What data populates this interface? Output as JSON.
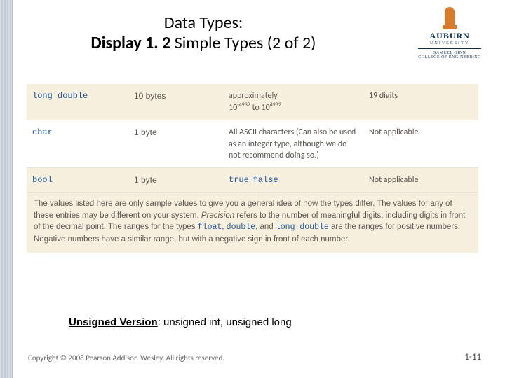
{
  "title": {
    "line1": "Data Types:",
    "boldPrefix": "Display 1. 2",
    "restLine2": "  Simple Types (2 of 2)"
  },
  "logo": {
    "name": "AUBURN",
    "sub": "UNIVERSITY",
    "college1": "SAMUEL GINN",
    "college2": "COLLEGE OF ENGINEERING"
  },
  "rows": [
    {
      "striped": true,
      "type_kw": "long double",
      "memory": "10 bytes",
      "range_html": "approximately<br>10<span class='sup'>-4932</span> to 10<span class='sup'>4932</span>",
      "precision": "19 digits"
    },
    {
      "striped": false,
      "type_kw": "char",
      "memory": "1 byte",
      "range_html": "All ASCII characters (Can also be used as an integer type, although we do not recommend doing so.)",
      "precision": "Not applicable"
    },
    {
      "striped": true,
      "type_kw": "bool",
      "memory": "1 byte",
      "range_html": "<span class='mono'>true</span>, <span class='mono'>false</span>",
      "precision": "Not applicable"
    }
  ],
  "footnote": "The values listed here are only sample values to give you a general idea of how the types differ. The values for any of these entries may be different on your system. <i>Precision</i> refers to the number of meaningful digits, including digits in front of the decimal point. The ranges for the types <span class='mono'>float</span>, <span class='mono'>double</span>, and <span class='mono'>long double</span> are the ranges for positive numbers. Negative numbers have a similar range, but with a negative sign in front of each number.",
  "unsigned": {
    "label": "Unsigned Version",
    "rest": ": unsigned int, unsigned long"
  },
  "copyright": "Copyright © 2008 Pearson Addison-Wesley. All rights reserved.",
  "page": "1-11"
}
